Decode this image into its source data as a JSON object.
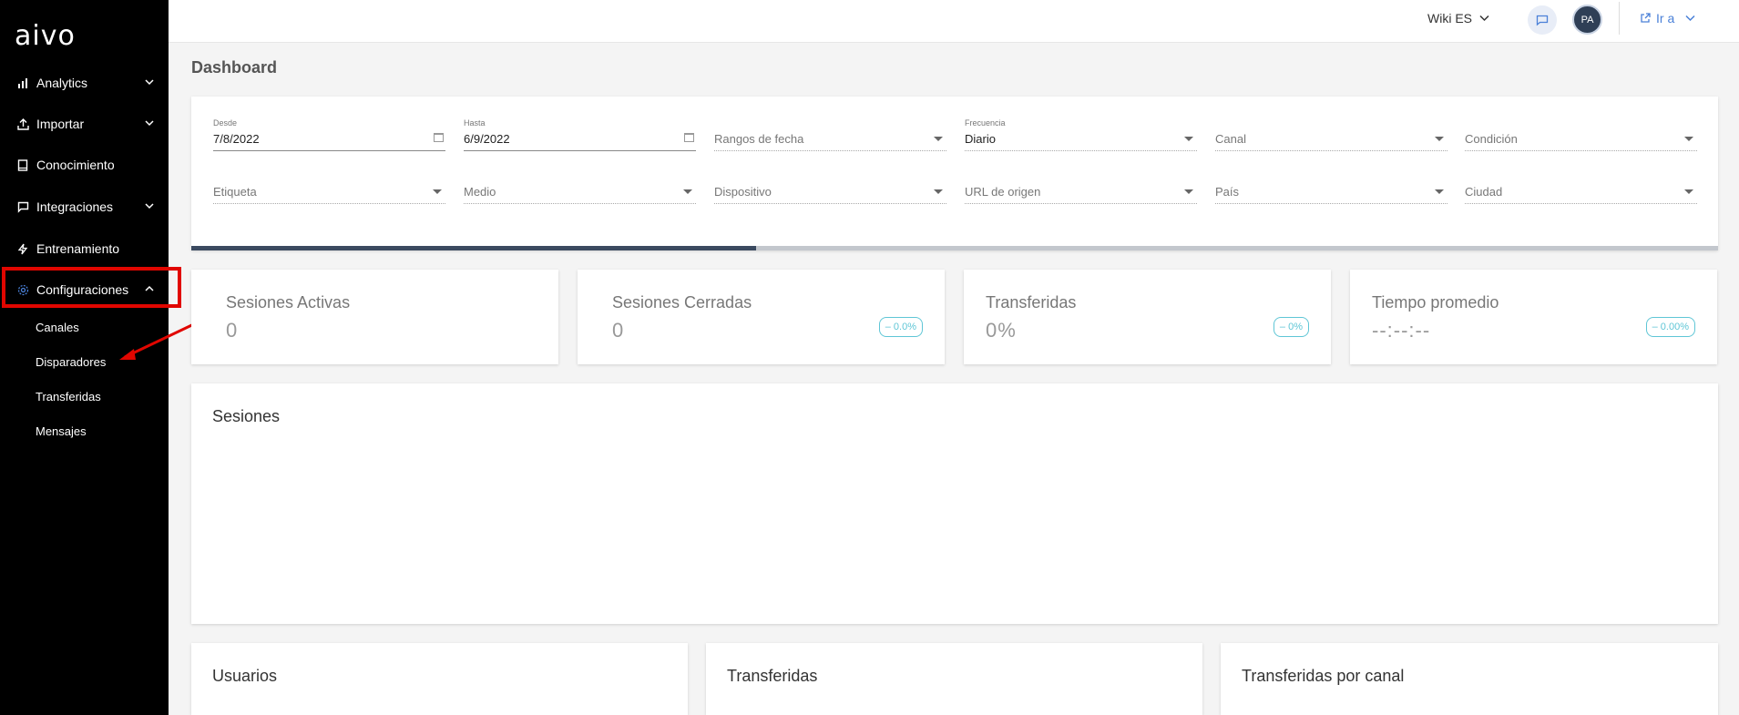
{
  "sidebar": {
    "logo": "aivo",
    "items": [
      {
        "label": "Analytics",
        "icon": "bar-chart-icon"
      },
      {
        "label": "Importar",
        "icon": "upload-icon"
      },
      {
        "label": "Conocimiento",
        "icon": "book-icon"
      },
      {
        "label": "Integraciones",
        "icon": "chat-bubble-icon"
      },
      {
        "label": "Entrenamiento",
        "icon": "bolt-icon"
      },
      {
        "label": "Configuraciones",
        "icon": "gear-icon"
      }
    ],
    "subitems": [
      {
        "label": "Canales"
      },
      {
        "label": "Disparadores"
      },
      {
        "label": "Transferidas"
      },
      {
        "label": "Mensajes"
      }
    ],
    "highlight_color": "#e10600"
  },
  "topbar": {
    "wiki": "Wiki ES",
    "avatar": "PA",
    "goto": "Ir a"
  },
  "page": {
    "title": "Dashboard"
  },
  "filters": {
    "desde": {
      "label": "Desde",
      "value": "7/8/2022"
    },
    "hasta": {
      "label": "Hasta",
      "value": "6/9/2022"
    },
    "rangos": {
      "placeholder": "Rangos de fecha"
    },
    "frecuencia": {
      "label": "Frecuencia",
      "value": "Diario"
    },
    "canal": {
      "placeholder": "Canal"
    },
    "condicion": {
      "placeholder": "Condición"
    },
    "etiqueta": {
      "placeholder": "Etiqueta"
    },
    "medio": {
      "placeholder": "Medio"
    },
    "dispositivo": {
      "placeholder": "Dispositivo"
    },
    "url_origen": {
      "placeholder": "URL de origen"
    },
    "pais": {
      "placeholder": "País"
    },
    "ciudad": {
      "placeholder": "Ciudad"
    },
    "progress_fraction": 0.37
  },
  "kpis": [
    {
      "title": "Sesiones Activas",
      "value": "0",
      "badge": ""
    },
    {
      "title": "Sesiones Cerradas",
      "value": "0",
      "badge": "– 0.0%"
    },
    {
      "title": "Transferidas",
      "value": "0%",
      "badge": "– 0%"
    },
    {
      "title": "Tiempo promedio",
      "value": "--:--:--",
      "badge": "– 0.00%"
    }
  ],
  "panels": {
    "sesiones": "Sesiones",
    "usuarios": "Usuarios",
    "transferidas": "Transferidas",
    "transferidas_canal": "Transferidas por canal"
  },
  "colors": {
    "sidebar_bg": "#000000",
    "accent": "#4a80d8",
    "badge": "#5fc6d6",
    "progress": "#3b4a60"
  }
}
